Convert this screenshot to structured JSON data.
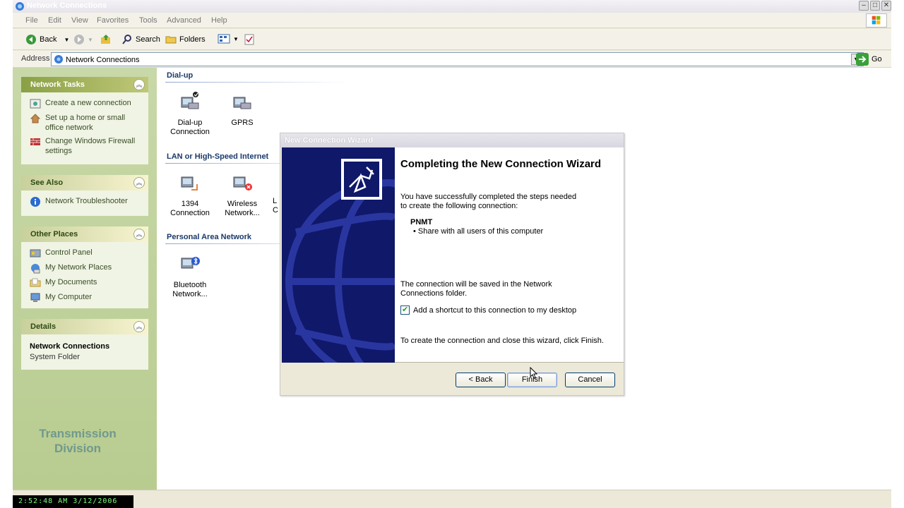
{
  "window": {
    "title": "Network Connections"
  },
  "menu": [
    "File",
    "Edit",
    "View",
    "Favorites",
    "Tools",
    "Advanced",
    "Help"
  ],
  "toolbar": {
    "back": "Back",
    "search": "Search",
    "folders": "Folders"
  },
  "address": {
    "label": "Address",
    "value": "Network Connections",
    "go": "Go"
  },
  "panels": {
    "network_tasks": {
      "title": "Network Tasks",
      "items": [
        "Create a new connection",
        "Set up a home or small office network",
        "Change Windows Firewall settings"
      ]
    },
    "see_also": {
      "title": "See Also",
      "items": [
        "Network Troubleshooter"
      ]
    },
    "other_places": {
      "title": "Other Places",
      "items": [
        "Control Panel",
        "My Network Places",
        "My Documents",
        "My Computer"
      ]
    },
    "details": {
      "title": "Details",
      "name": "Network Connections",
      "type": "System Folder"
    }
  },
  "watermark": {
    "line1": "Transmission",
    "line2": "Division"
  },
  "groups": {
    "dialup": {
      "title": "Dial-up",
      "items": [
        {
          "label": "Dial-up Connection"
        },
        {
          "label": "GPRS"
        }
      ]
    },
    "lan": {
      "title": "LAN or High-Speed Internet",
      "items": [
        {
          "label": "1394 Connection"
        },
        {
          "label": "Wireless Network..."
        },
        {
          "label": "L C"
        }
      ]
    },
    "pan": {
      "title": "Personal Area Network",
      "items": [
        {
          "label": "Bluetooth Network..."
        }
      ]
    }
  },
  "wizard": {
    "title": "New Connection Wizard",
    "heading": "Completing the New Connection Wizard",
    "intro": "You have successfully completed the steps needed to create the following connection:",
    "connection_name": "PNMT",
    "bullet": "Share with all users of this computer",
    "saved_note": "The connection will be saved in the Network Connections folder.",
    "shortcut_label": "Add a shortcut to this connection to my desktop",
    "shortcut_checked": true,
    "finish_note": "To create the connection and close this wizard, click Finish.",
    "buttons": {
      "back": "< Back",
      "finish": "Finish",
      "cancel": "Cancel"
    }
  },
  "clock": "2:52:48 AM 3/12/2006",
  "colors": {
    "panel_bg": "#c8d8a8",
    "wizard_art": "#10186a",
    "heading_blue": "#1a3a6a"
  }
}
